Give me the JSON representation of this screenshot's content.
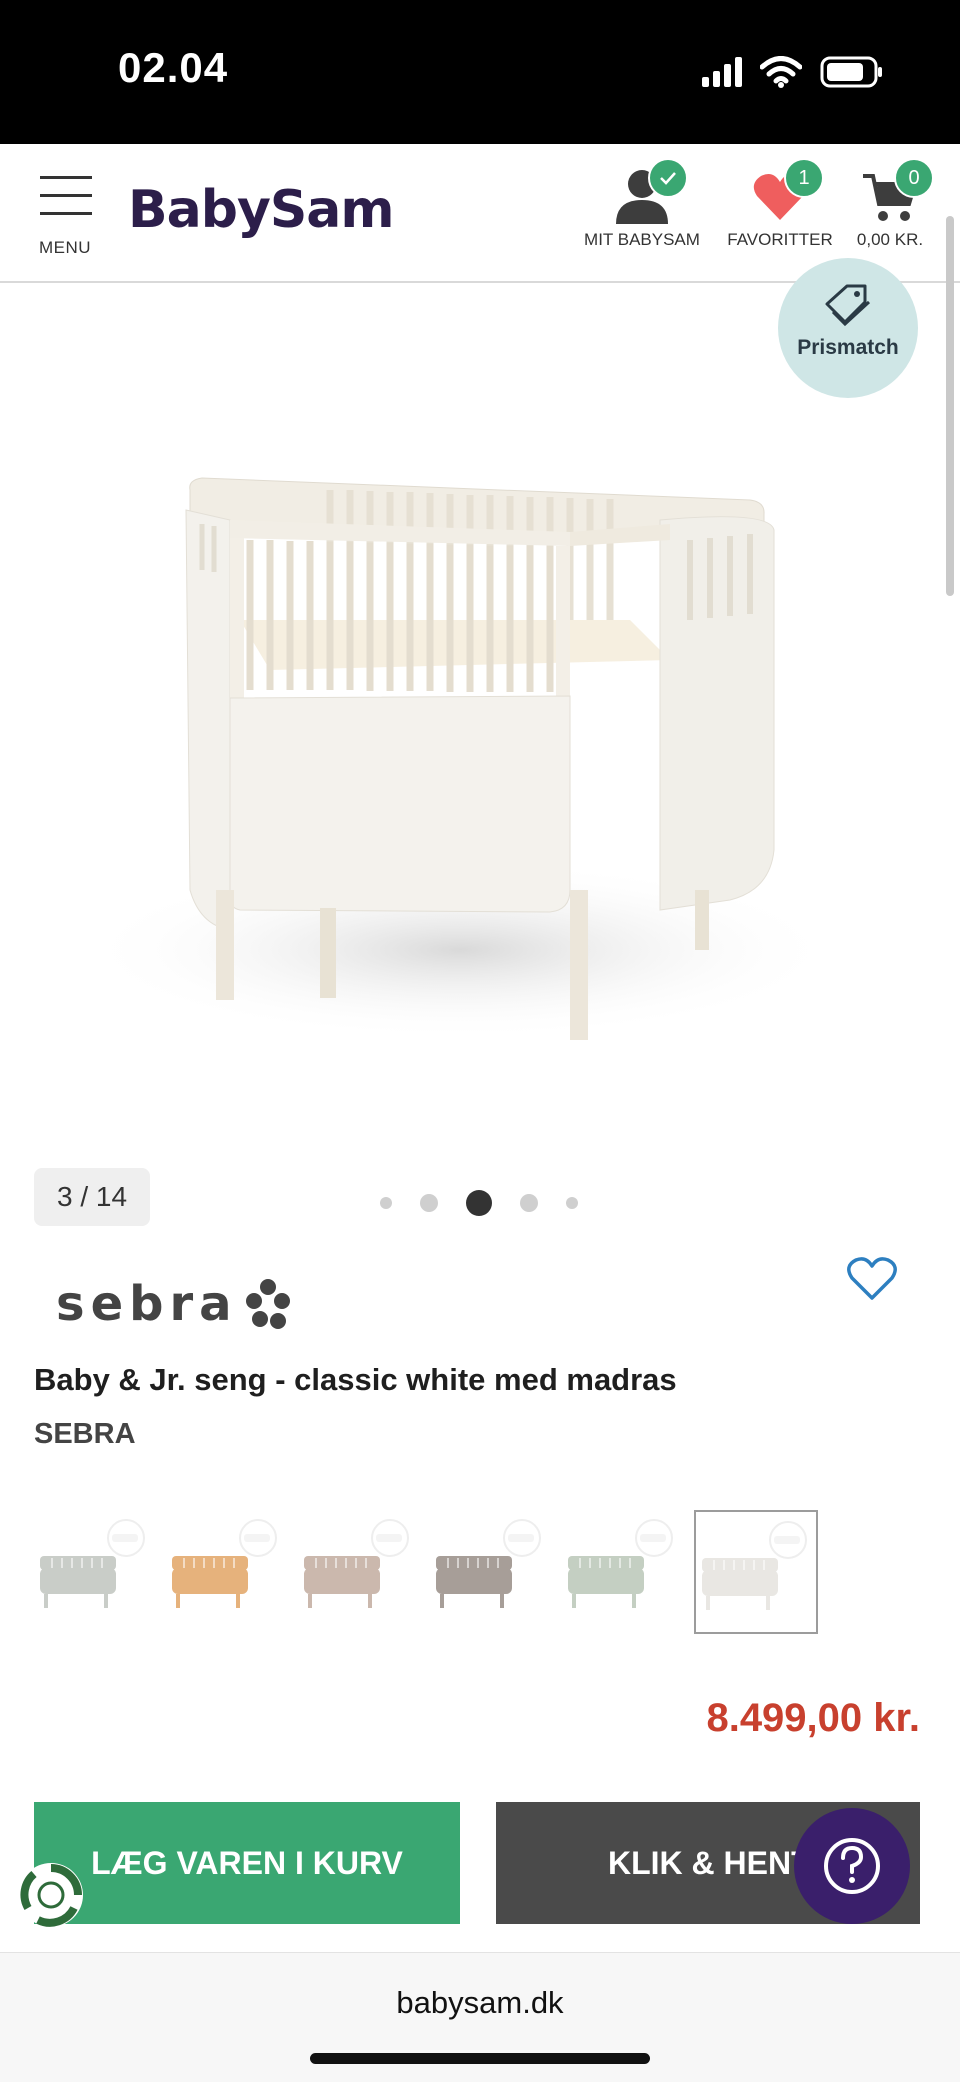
{
  "status_bar": {
    "time": "02.04"
  },
  "header": {
    "menu_label": "MENU",
    "logo": "BabySam",
    "account": {
      "label": "MIT BABYSAM"
    },
    "favorites": {
      "label": "FAVORITTER",
      "count": "1"
    },
    "cart": {
      "label": "0,00 KR.",
      "count": "0"
    }
  },
  "gallery": {
    "prismatch_label": "Prismatch",
    "counter": "3 / 14",
    "dot_count": 5,
    "active_dot": 3
  },
  "product": {
    "brand_logo": "sebra",
    "title": "Baby & Jr. seng - classic white med madras",
    "brand": "SEBRA",
    "variant_colors": [
      "#c9cdc8",
      "#e6b27c",
      "#cbb8ad",
      "#a79e98",
      "#c4cfc2",
      "#e9e7e3"
    ],
    "selected_variant": 6,
    "price": "8.499,00 kr."
  },
  "actions": {
    "add_to_cart": "LÆG VAREN I KURV",
    "click_collect": "KLIK & HENT"
  },
  "browser": {
    "url": "babysam.dk"
  },
  "colors": {
    "accent_green": "#3aa772",
    "price_red": "#c8402e",
    "brand_purple": "#2c1e4a",
    "help_purple": "#3a1f6b"
  }
}
